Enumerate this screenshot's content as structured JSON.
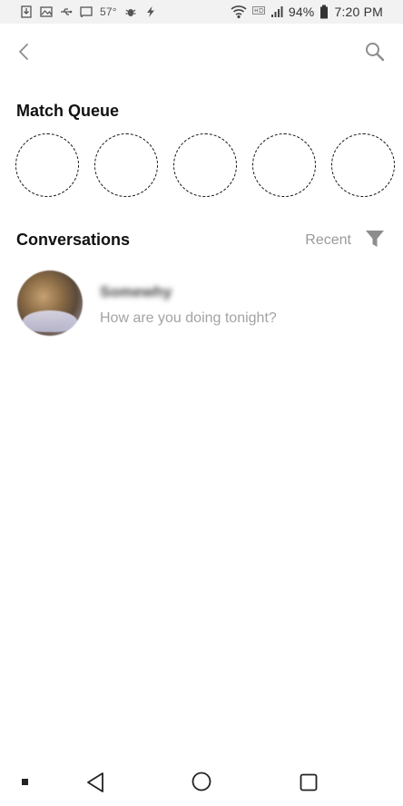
{
  "status_bar": {
    "temperature": "57°",
    "battery": "94%",
    "time": "7:20 PM",
    "icons": [
      "download-icon",
      "image-icon",
      "usb-icon",
      "cast-icon",
      "bug-icon",
      "flash-icon",
      "wifi-icon",
      "hd-icon",
      "signal-icon",
      "battery-icon"
    ]
  },
  "app_bar": {
    "back_icon": "chevron-left-icon",
    "search_icon": "search-icon"
  },
  "match_queue": {
    "title": "Match Queue",
    "slots": 5
  },
  "conversations": {
    "title": "Conversations",
    "sort_label": "Recent",
    "filter_icon": "filter-icon",
    "items": [
      {
        "name": "Somewhy",
        "preview": "How are you doing tonight?"
      }
    ]
  },
  "nav_bar": {
    "icons": [
      "dot-icon",
      "back-triangle-icon",
      "home-circle-icon",
      "recents-square-icon"
    ]
  },
  "colors": {
    "background": "#ffffff",
    "status_bar": "#f2f2f2",
    "text_primary": "#111111",
    "text_secondary": "#9a9a9a"
  }
}
